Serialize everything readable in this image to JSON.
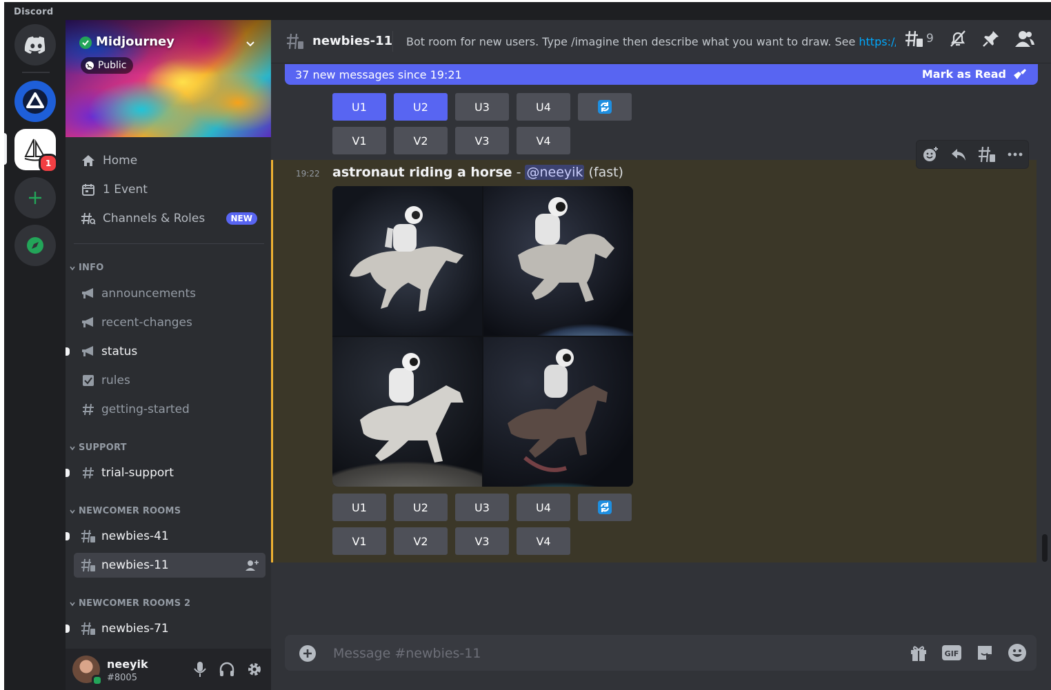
{
  "window": {
    "title": "Discord"
  },
  "rail": {
    "dm_badge": "1"
  },
  "server": {
    "name": "Midjourney",
    "visibility": "Public"
  },
  "nav": {
    "home": "Home",
    "events": "1 Event",
    "channels_roles": "Channels & Roles",
    "new_badge": "NEW"
  },
  "categories": {
    "info": "INFO",
    "support": "SUPPORT",
    "newcomer": "NEWCOMER ROOMS",
    "newcomer2": "NEWCOMER ROOMS 2"
  },
  "channels": {
    "announcements": "announcements",
    "recent_changes": "recent-changes",
    "status": "status",
    "rules": "rules",
    "getting_started": "getting-started",
    "trial_support": "trial-support",
    "newbies41": "newbies-41",
    "newbies11": "newbies-11",
    "newbies71": "newbies-71"
  },
  "user": {
    "name": "neeyik",
    "tag": "#8005"
  },
  "header": {
    "channel": "newbies-11",
    "topic": "Bot room for new users. Type /imagine then describe what you want to draw. See ",
    "topic_link": "https://docs...",
    "threads_count": "9"
  },
  "newbar": {
    "text": "37 new messages since 19:21",
    "action": "Mark as Read"
  },
  "buttons": {
    "u1": "U1",
    "u2": "U2",
    "u3": "U3",
    "u4": "U4",
    "v1": "V1",
    "v2": "V2",
    "v3": "V3",
    "v4": "V4"
  },
  "message": {
    "time": "19:22",
    "prompt": "astronaut riding a horse",
    "dash": " - ",
    "mention": "@neeyik",
    "mode": " (fast)"
  },
  "composer": {
    "placeholder": "Message #newbies-11"
  },
  "colors": {
    "blurple": "#5865f2",
    "highlight": "#f0b232",
    "online": "#23a559",
    "link": "#00a8fc"
  }
}
